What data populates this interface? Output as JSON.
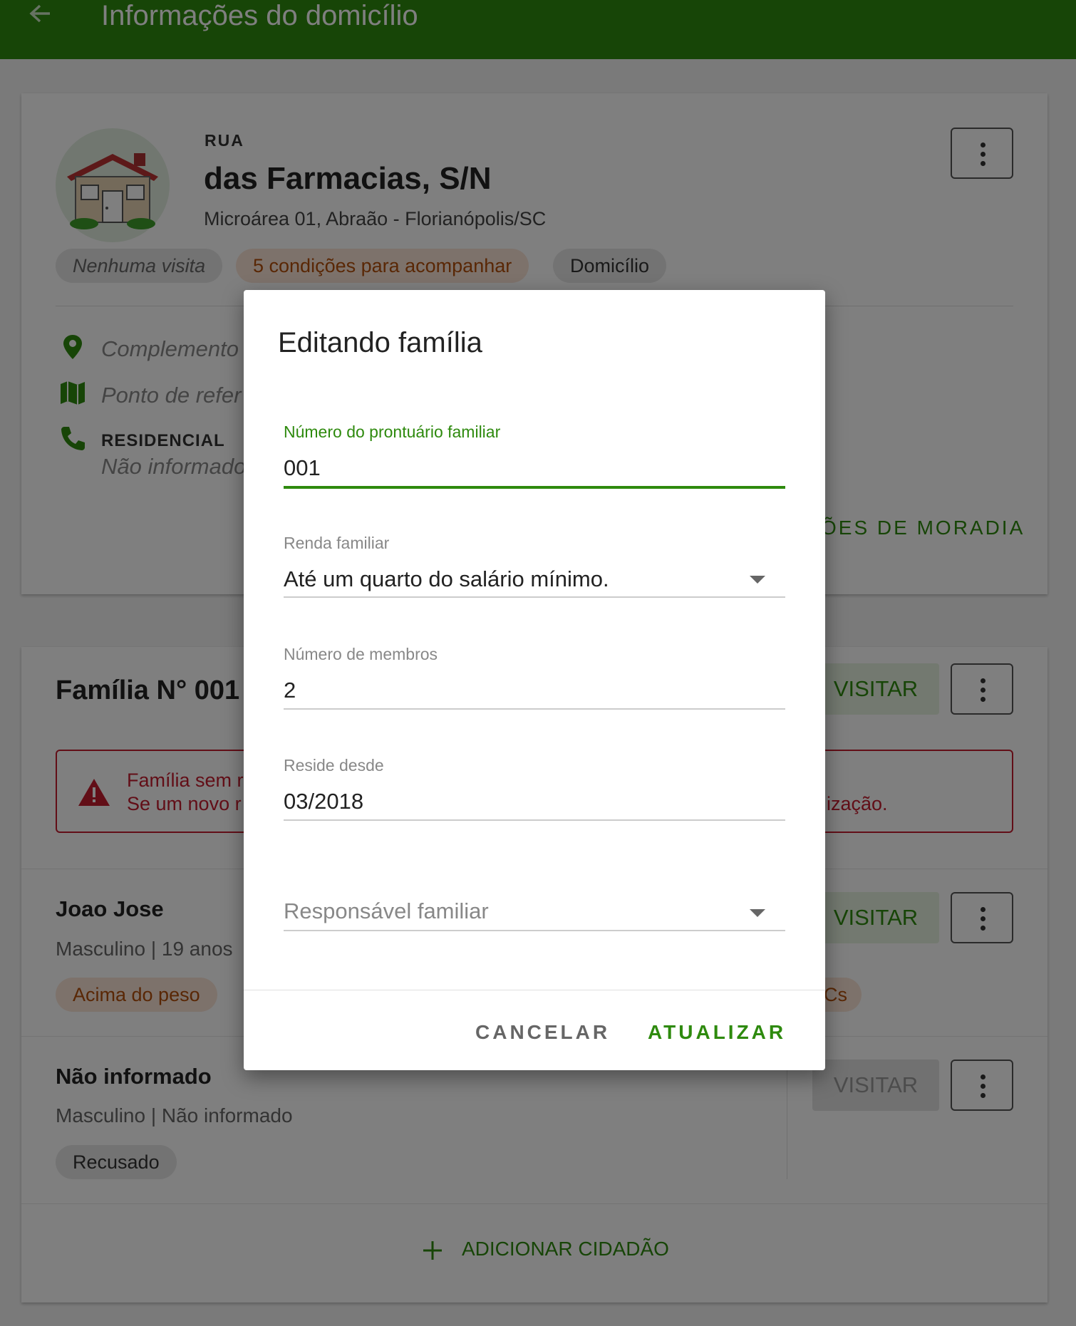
{
  "appbar": {
    "title": "Informações do domicílio"
  },
  "household": {
    "street_type": "RUA",
    "address": "das Farmacias, S/N",
    "subaddress": "Microárea 01, Abraão - Florianópolis/SC",
    "chips": [
      "Nenhuma visita",
      "5 condições para acompanhar",
      "Domicílio"
    ],
    "complement": "Complemento",
    "reference": "Ponto de refer",
    "phone_label": "RESIDENCIAL",
    "phone_value": "Não informado",
    "housing_link": "ÕES DE MORADIA"
  },
  "family": {
    "title": "Família N° 001",
    "visit_label": "VISITAR",
    "alert_line1": "Família sem r",
    "alert_line2": "Se um novo r",
    "alert_tail": "ização.",
    "members": [
      {
        "name": "Joao Jose",
        "sub": "Masculino | 19 anos",
        "chip": "Acima do peso",
        "chip_tail": "Cs",
        "visit": "VISITAR"
      },
      {
        "name": "Não informado",
        "sub": "Masculino | Não informado",
        "chip": "Recusado",
        "visit": "VISITAR"
      }
    ],
    "add_label": "ADICIONAR CIDADÃO"
  },
  "dialog": {
    "title": "Editando família",
    "prontuario_label": "Número do prontuário familiar",
    "prontuario_value": "001",
    "renda_label": "Renda familiar",
    "renda_value": "Até um quarto do salário mínimo.",
    "membros_label": "Número de membros",
    "membros_value": "2",
    "reside_label": "Reside desde",
    "reside_value": "03/2018",
    "responsavel_placeholder": "Responsável familiar",
    "cancel_label": "CANCELAR",
    "update_label": "ATUALIZAR"
  },
  "colors": {
    "primary": "#2e8a0e",
    "alert": "#c41d2f",
    "orange_chip": "#fbe5d6"
  },
  "icons": [
    "arrow-left-icon",
    "more-vert-icon",
    "location-pin-icon",
    "map-icon",
    "phone-icon",
    "warning-icon",
    "plus-icon",
    "dropdown-caret-icon",
    "house-illustration"
  ]
}
